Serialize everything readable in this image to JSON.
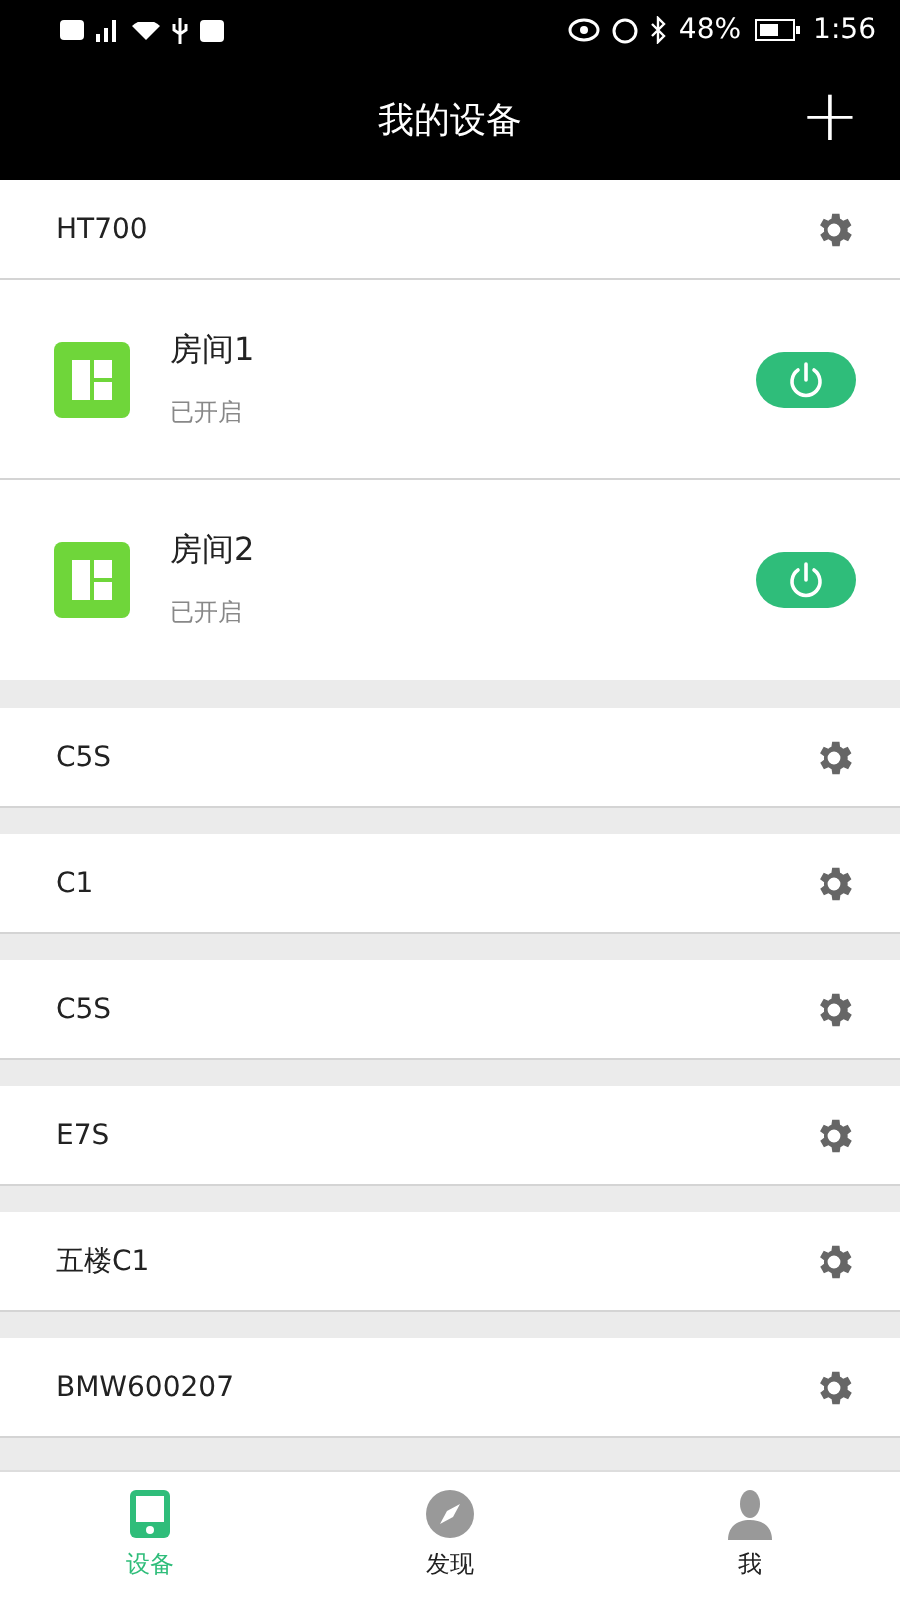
{
  "status_bar": {
    "battery": "48%",
    "time": "1:56"
  },
  "header": {
    "title": "我的设备",
    "add": "+"
  },
  "devices": [
    {
      "name": "HT700",
      "rooms": [
        {
          "name": "房间1",
          "status": "已开启",
          "on": true
        },
        {
          "name": "房间2",
          "status": "已开启",
          "on": true
        }
      ]
    },
    {
      "name": "C5S"
    },
    {
      "name": "C1"
    },
    {
      "name": "C5S"
    },
    {
      "name": "E7S"
    },
    {
      "name": "五楼C1"
    },
    {
      "name": "BMW600207"
    }
  ],
  "tabs": [
    {
      "label": "设备",
      "kind": "device",
      "selected": true
    },
    {
      "label": "发现",
      "kind": "discover",
      "selected": false
    },
    {
      "label": "我",
      "kind": "me",
      "selected": false
    }
  ]
}
